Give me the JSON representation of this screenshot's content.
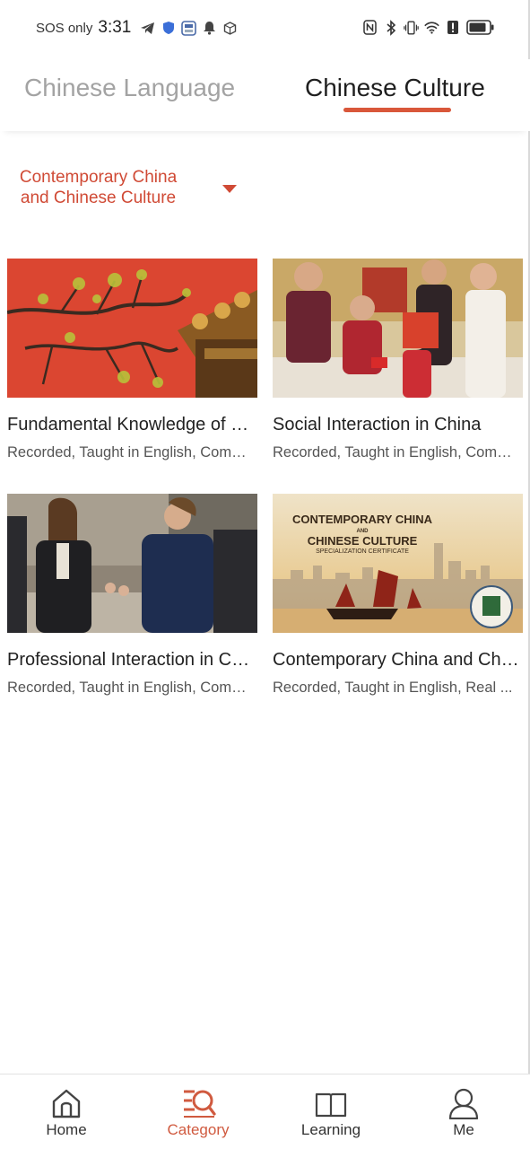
{
  "status_bar": {
    "carrier": "SOS only",
    "time": "3:31"
  },
  "tabs": [
    {
      "label": "Chinese Language",
      "active": false
    },
    {
      "label": "Chinese Culture",
      "active": true
    }
  ],
  "filter": {
    "line1": "Contemporary China",
    "line2": "and Chinese Culture"
  },
  "courses": [
    {
      "title": "Fundamental Knowledge of Chinese Culture",
      "subtitle": "Recorded, Taught in English, Completed"
    },
    {
      "title": "Social Interaction in China",
      "subtitle": "Recorded, Taught in English, Completed"
    },
    {
      "title": "Professional Interaction in China",
      "subtitle": "Recorded, Taught in English, Completed"
    },
    {
      "title": "Contemporary China and Chinese Culture",
      "subtitle": "Recorded, Taught in English, Real ..."
    }
  ],
  "certificate_image": {
    "line1": "CONTEMPORARY CHINA",
    "line2": "AND",
    "line3": "CHINESE CULTURE",
    "line4": "SPECIALIZATION CERTIFICATE"
  },
  "bottom_nav": [
    {
      "label": "Home",
      "icon": "home-icon",
      "active": false
    },
    {
      "label": "Category",
      "icon": "category-icon",
      "active": true
    },
    {
      "label": "Learning",
      "icon": "book-icon",
      "active": false
    },
    {
      "label": "Me",
      "icon": "person-icon",
      "active": false
    }
  ],
  "colors": {
    "accent": "#d9573a",
    "inactive_tab": "#a3a3a3"
  }
}
